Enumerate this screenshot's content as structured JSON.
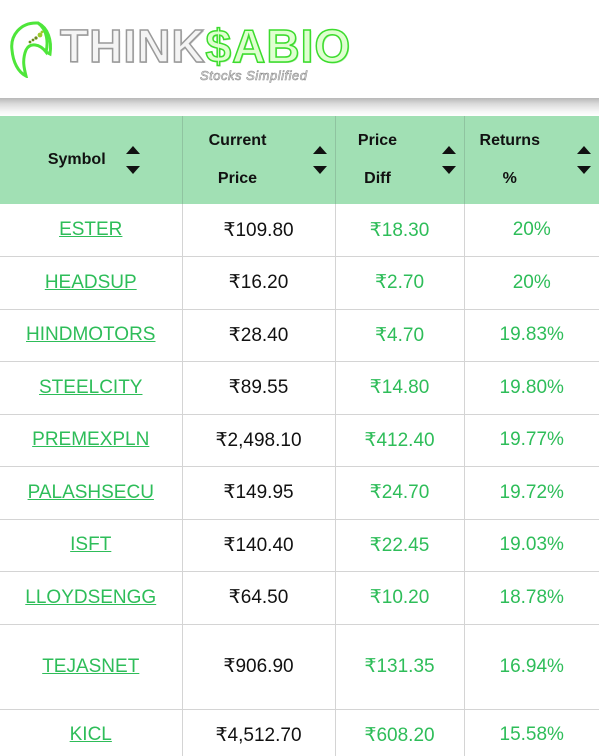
{
  "brand": {
    "name_part1": "THINK",
    "name_part2": "$ABIO",
    "tagline": "Stocks Simplified",
    "accent_color": "#3ddc2e"
  },
  "table": {
    "header_bg": "#a1e0b4",
    "positive_color": "#2ebd59",
    "columns": [
      {
        "line1": "Symbol",
        "line2": "",
        "sort_icon": "sort-updown-icon"
      },
      {
        "line1": "Current",
        "line2": "Price",
        "sort_icon": "sort-updown-icon"
      },
      {
        "line1": "Price",
        "line2": "Diff",
        "sort_icon": "sort-updown-icon"
      },
      {
        "line1": "Returns",
        "line2": "%",
        "sort_icon": "sort-updown-icon"
      }
    ],
    "rows": [
      {
        "symbol": "ESTER",
        "price": "₹109.80",
        "diff": "₹18.30",
        "returns": "20%"
      },
      {
        "symbol": "HEADSUP",
        "price": "₹16.20",
        "diff": "₹2.70",
        "returns": "20%"
      },
      {
        "symbol": "HINDMOTORS",
        "price": "₹28.40",
        "diff": "₹4.70",
        "returns": "19.83%"
      },
      {
        "symbol": "STEELCITY",
        "price": "₹89.55",
        "diff": "₹14.80",
        "returns": "19.80%"
      },
      {
        "symbol": "PREMEXPLN",
        "price": "₹2,498.10",
        "diff": "₹412.40",
        "returns": "19.77%"
      },
      {
        "symbol": "PALASHSECU",
        "price": "₹149.95",
        "diff": "₹24.70",
        "returns": "19.72%"
      },
      {
        "symbol": "ISFT",
        "price": "₹140.40",
        "diff": "₹22.45",
        "returns": "19.03%"
      },
      {
        "symbol": "LLOYDSENGG",
        "price": "₹64.50",
        "diff": "₹10.20",
        "returns": "18.78%"
      },
      {
        "symbol": "TEJASNET",
        "price": "₹906.90",
        "diff": "₹131.35",
        "returns": "16.94%"
      },
      {
        "symbol": "KICL",
        "price": "₹4,512.70",
        "diff": "₹608.20",
        "returns": "15.58%"
      }
    ]
  }
}
